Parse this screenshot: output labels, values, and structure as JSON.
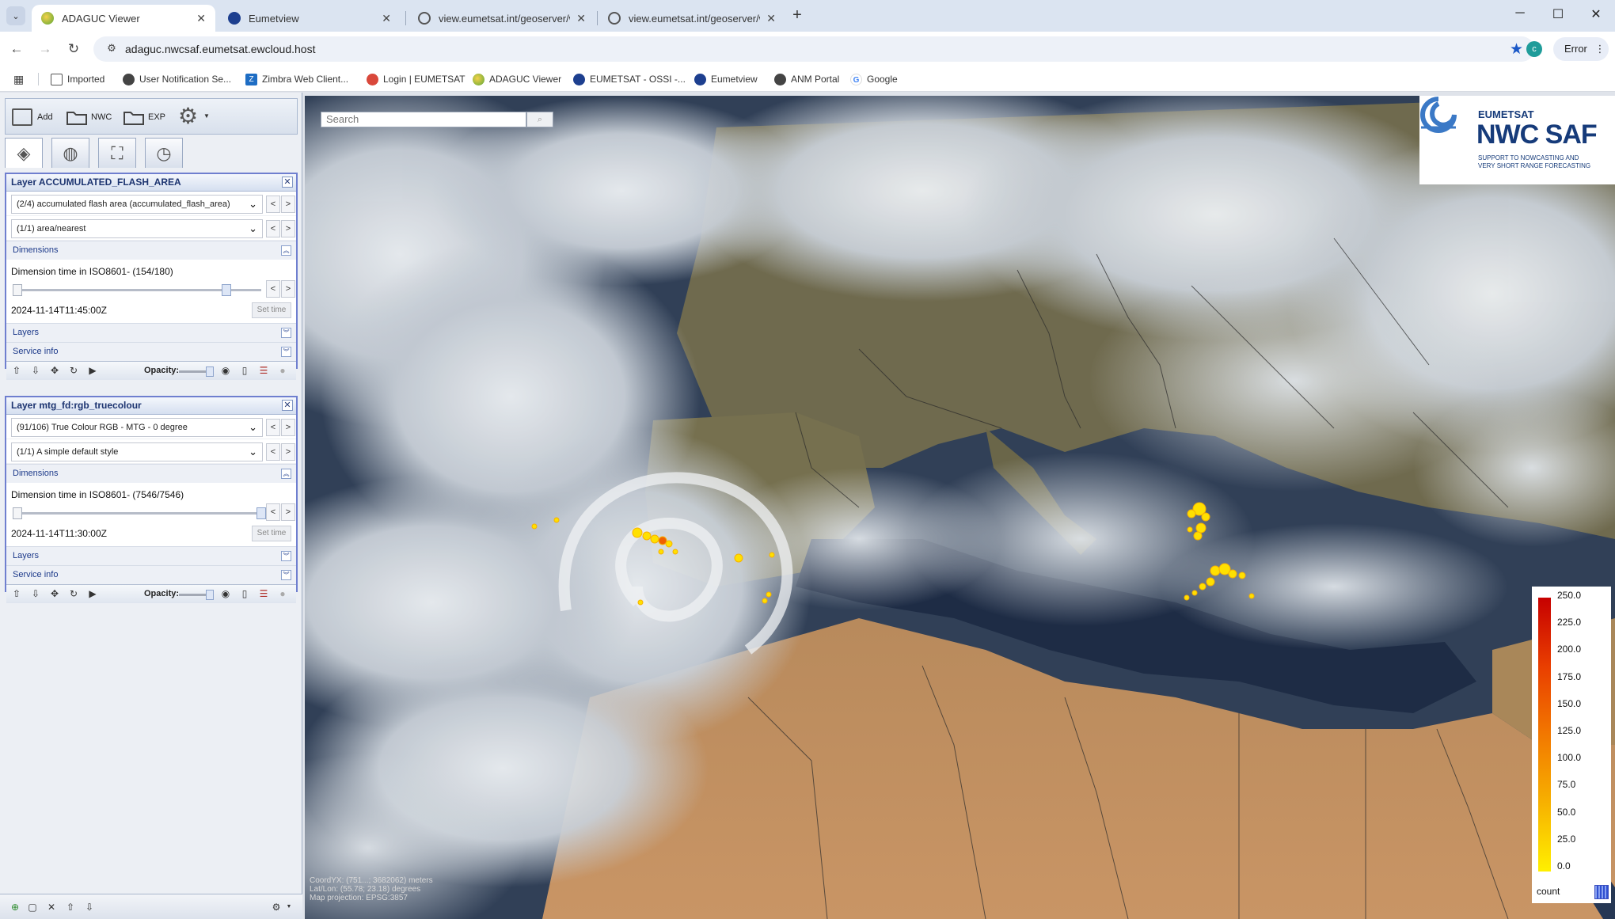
{
  "browser": {
    "tabs": [
      {
        "title": "ADAGUC Viewer",
        "active": true
      },
      {
        "title": "Eumetview",
        "active": false
      },
      {
        "title": "view.eumetsat.int/geoserver/wr",
        "active": false
      },
      {
        "title": "view.eumetsat.int/geoserver/wr",
        "active": false
      }
    ],
    "url": "adaguc.nwcsaf.eumetsat.ewcloud.host",
    "profile_initial": "c",
    "error_label": "Error",
    "bookmarks": [
      {
        "label": "Imported",
        "icon": "folder-icon"
      },
      {
        "label": "User Notification Se...",
        "icon": "globe-icon"
      },
      {
        "label": "Zimbra Web Client...",
        "icon": "zimbra-icon"
      },
      {
        "label": "Login | EUMETSAT",
        "icon": "eumetsat-icon"
      },
      {
        "label": "ADAGUC Viewer",
        "icon": "adaguc-icon"
      },
      {
        "label": "EUMETSAT - OSSI -...",
        "icon": "eumetsat-icon"
      },
      {
        "label": "Eumetview",
        "icon": "eumetview-icon"
      },
      {
        "label": "ANM Portal",
        "icon": "globe-icon"
      },
      {
        "label": "Google",
        "icon": "google-icon"
      }
    ]
  },
  "toolbar": {
    "add_label": "Add",
    "nwc_label": "NWC",
    "exp_label": "EXP"
  },
  "layers": [
    {
      "title": "Layer ACCUMULATED_FLASH_AREA",
      "product": "(2/4) accumulated flash area (accumulated_flash_area)",
      "style": "(1/1) area/nearest",
      "dimensions_label": "Dimensions",
      "dim_title": "Dimension time in ISO8601- (154/180)",
      "dim_value": "2024-11-14T11:45:00Z",
      "set_time_label": "Set time",
      "slider_fraction": 0.855,
      "layers_label": "Layers",
      "service_label": "Service info",
      "opacity_label": "Opacity:"
    },
    {
      "title": "Layer mtg_fd:rgb_truecolour",
      "product": "(91/106) True Colour RGB - MTG - 0 degree",
      "style": "(1/1) A simple default style",
      "dimensions_label": "Dimensions",
      "dim_title": "Dimension time in ISO8601- (7546/7546)",
      "dim_value": "2024-11-14T11:30:00Z",
      "set_time_label": "Set time",
      "slider_fraction": 1.0,
      "layers_label": "Layers",
      "service_label": "Service info",
      "opacity_label": "Opacity:"
    }
  ],
  "map": {
    "search_placeholder": "Search",
    "logo": {
      "org": "EUMETSAT",
      "name": "NWC SAF",
      "tagline_1": "SUPPORT TO NOWCASTING AND",
      "tagline_2": "VERY SHORT RANGE FORECASTING"
    },
    "legend": {
      "ticks": [
        "250.0",
        "225.0",
        "200.0",
        "175.0",
        "150.0",
        "125.0",
        "100.0",
        "75.0",
        "50.0",
        "25.0",
        "0.0"
      ],
      "unit": "count"
    },
    "coords": {
      "line1": "CoordYX: (751...; 3682062) meters",
      "line2": "Lat/Lon: (55.78; 23.18) degrees",
      "line3": "Map projection: EPSG:3857"
    }
  },
  "colors": {
    "panel_border": "#6f7fcf",
    "header_text": "#1c3470",
    "legend_top": "#c60000",
    "legend_bottom": "#fff000",
    "lightning": "#ffe000"
  }
}
